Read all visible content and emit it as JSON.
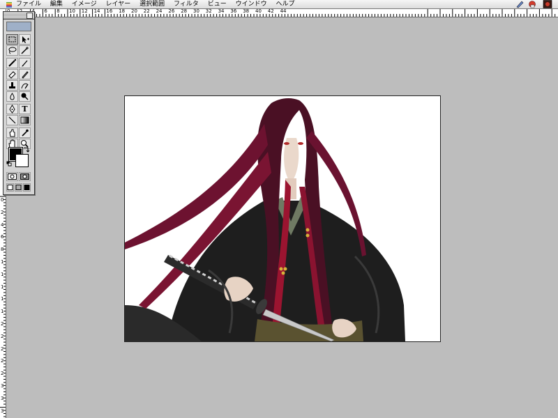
{
  "menubar": {
    "items": [
      "ファイル",
      "編集",
      "イメージ",
      "レイヤー",
      "選択範囲",
      "フィルタ",
      "ビュー",
      "ウインドウ",
      "ヘルプ"
    ]
  },
  "rulers": {
    "h_labels": [
      "0",
      "2",
      "4",
      "6",
      "8",
      "10",
      "12",
      "14",
      "16",
      "18",
      "20",
      "22",
      "24",
      "26",
      "28",
      "30",
      "32",
      "34",
      "36",
      "38",
      "40",
      "42",
      "44"
    ],
    "v_labels": [
      "0",
      "2",
      "4",
      "6",
      "8",
      "10",
      "12",
      "14",
      "16",
      "18",
      "20",
      "22",
      "24",
      "26",
      "28",
      "30",
      "32",
      "34"
    ]
  },
  "toolbox": {
    "type_tool_label": "T",
    "tools": [
      "marquee-tool",
      "move-tool",
      "lasso-tool",
      "magic-wand-tool",
      "airbrush-tool",
      "paintbrush-tool",
      "eraser-tool",
      "pencil-tool",
      "rubber-stamp-tool",
      "history-brush-tool",
      "blur-tool",
      "burn-tool",
      "pen-tool",
      "type-tool",
      "line-tool",
      "gradient-tool",
      "paint-bucket-tool",
      "eyedropper-tool",
      "hand-tool",
      "zoom-tool"
    ]
  },
  "colors": {
    "foreground": "#000000",
    "background": "#ffffff",
    "workspace": "#bdbdbd"
  },
  "document": {
    "content": "illustration of long dark-red-haired swordsman in black kimono unsheathing katana"
  }
}
